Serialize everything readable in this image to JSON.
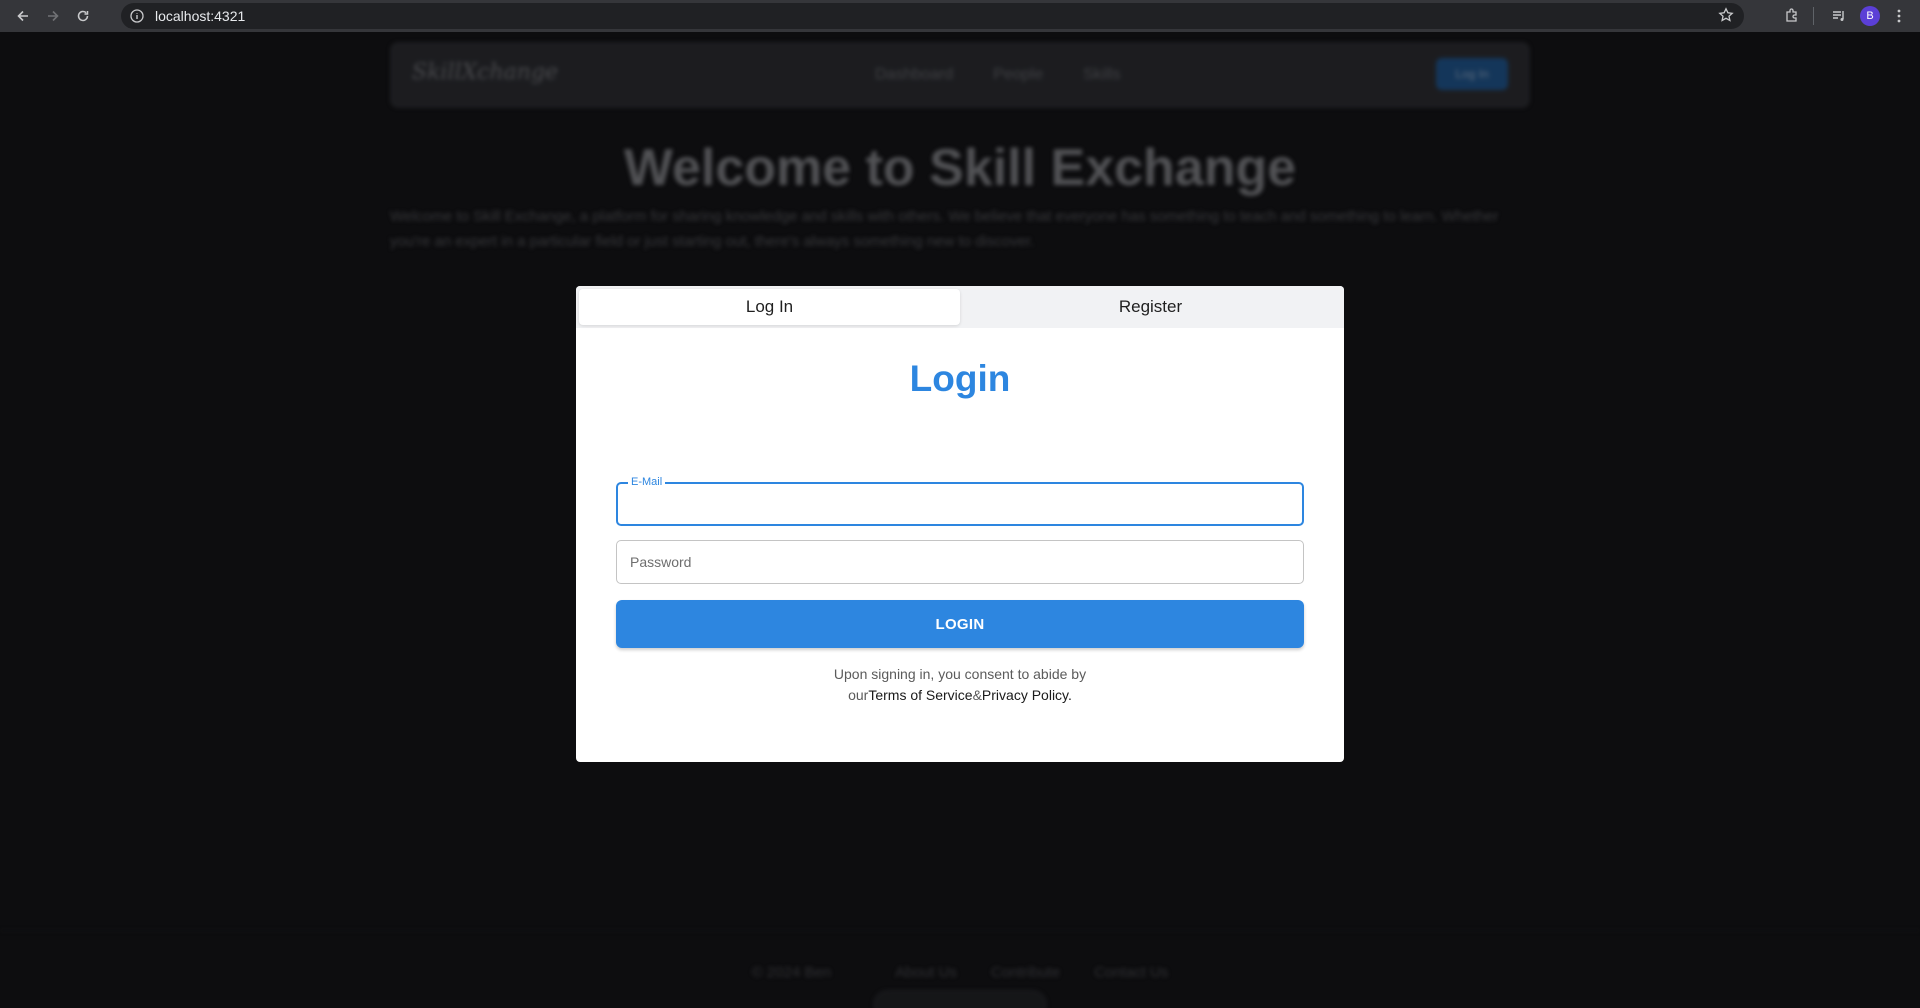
{
  "browser": {
    "url": "localhost:4321",
    "profile_initial": "B"
  },
  "site": {
    "logo": "SkillXchange",
    "nav": [
      "Dashboard",
      "People",
      "Skills"
    ],
    "nav_login": "Log In",
    "hero_title": "Welcome to Skill Exchange",
    "hero_text": "Welcome to Skill Exchange, a platform for sharing knowledge and skills with others. We believe that everyone has something to teach and something to learn. Whether you're an expert in a particular field or just starting out, there's always something new to discover.",
    "footer": {
      "copyright": "© 2024 Ben",
      "links": [
        "About Us",
        "Contribute",
        "Contact Us"
      ]
    }
  },
  "modal": {
    "tabs": [
      "Log In",
      "Register"
    ],
    "active_tab": "Log In",
    "title": "Login",
    "email": {
      "label": "E-Mail",
      "value": ""
    },
    "password": {
      "placeholder": "Password",
      "value": ""
    },
    "submit_label": "LOGIN",
    "consent": {
      "line1": "Upon signing in, you consent to abide by",
      "prefix": "our",
      "terms": "Terms of Service",
      "amp": "&",
      "privacy": "Privacy Policy."
    }
  },
  "colors": {
    "accent": "#2d86e0",
    "backdrop": "#0d0d0f",
    "chrome": "#35363a"
  }
}
